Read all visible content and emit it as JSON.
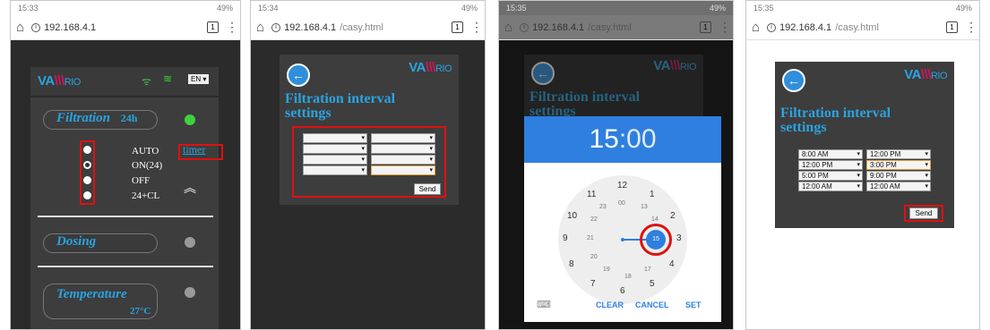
{
  "phones": [
    {
      "time": "15:33",
      "signal": "49%",
      "url_host": "192.168.4.1",
      "url_path": ""
    },
    {
      "time": "15:34",
      "signal": "49%",
      "url_host": "192.168.4.1",
      "url_path": "/casy.html"
    },
    {
      "time": "15:35",
      "signal": "49%",
      "url_host": "192.168.4.1",
      "url_path": "/casy.html"
    },
    {
      "time": "15:35",
      "signal": "49%",
      "url_host": "192.168.4.1",
      "url_path": "/casy.html"
    }
  ],
  "tab_count": "1",
  "logo": {
    "a": "VA",
    "b": "RIO"
  },
  "lang": "EN ▾",
  "screen1": {
    "filtration_label": "Filtration",
    "filtration_hours": "24h",
    "modes": [
      "AUTO",
      "ON(24)",
      "OFF",
      "24+CL"
    ],
    "timer_link": "timer",
    "collapse_icon": "^",
    "dosing_label": "Dosing",
    "temperature_label": "Temperature",
    "temperature_value": "27°C"
  },
  "interval": {
    "title_line1": "Filtration interval",
    "title_line2": "settings",
    "send_label": "Send",
    "start_times": [
      "8:00 AM",
      "12:00 PM",
      "5:00 PM",
      "12:00 AM"
    ],
    "end_times": [
      "12:00 PM",
      "3:00 PM",
      "9:00 PM",
      "12:00 AM"
    ]
  },
  "picker": {
    "hour": "15",
    "minute": ":00",
    "outer": [
      "12",
      "1",
      "2",
      "3",
      "4",
      "5",
      "6",
      "7",
      "8",
      "9",
      "10",
      "11"
    ],
    "inner": [
      "00",
      "13",
      "14",
      "15",
      "16",
      "17",
      "18",
      "19",
      "20",
      "21",
      "22",
      "23"
    ],
    "clear": "CLEAR",
    "cancel": "CANCEL",
    "set": "SET"
  },
  "colors": {
    "accent": "#2aa3e0",
    "highlight": "#e01010",
    "picker_blue": "#2f7fe0",
    "status_green": "#3fd23f"
  }
}
